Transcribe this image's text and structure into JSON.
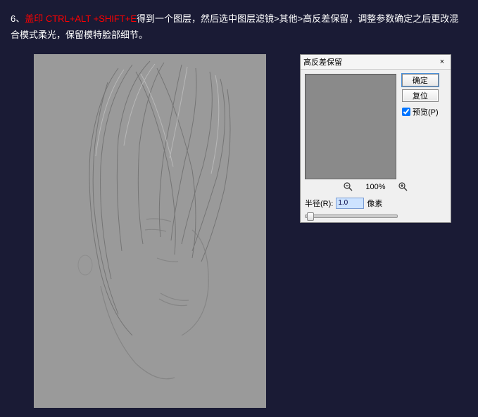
{
  "instruction": {
    "step": "6、",
    "highlight": "盖印 CTRL+ALT +SHIFT+E",
    "rest": "得到一个图层，然后选中图层滤镜>其他>高反差保留，调整参数确定之后更改混合模式柔光，保留模特脸部细节。"
  },
  "dialog": {
    "title": "高反差保留",
    "close": "×",
    "ok": "确定",
    "cancel": "复位",
    "preview_label": "预览(P)",
    "preview_checked": true,
    "zoom_percent": "100%",
    "radius_label": "半径(R):",
    "radius_value": "1.0",
    "radius_unit": "像素"
  }
}
